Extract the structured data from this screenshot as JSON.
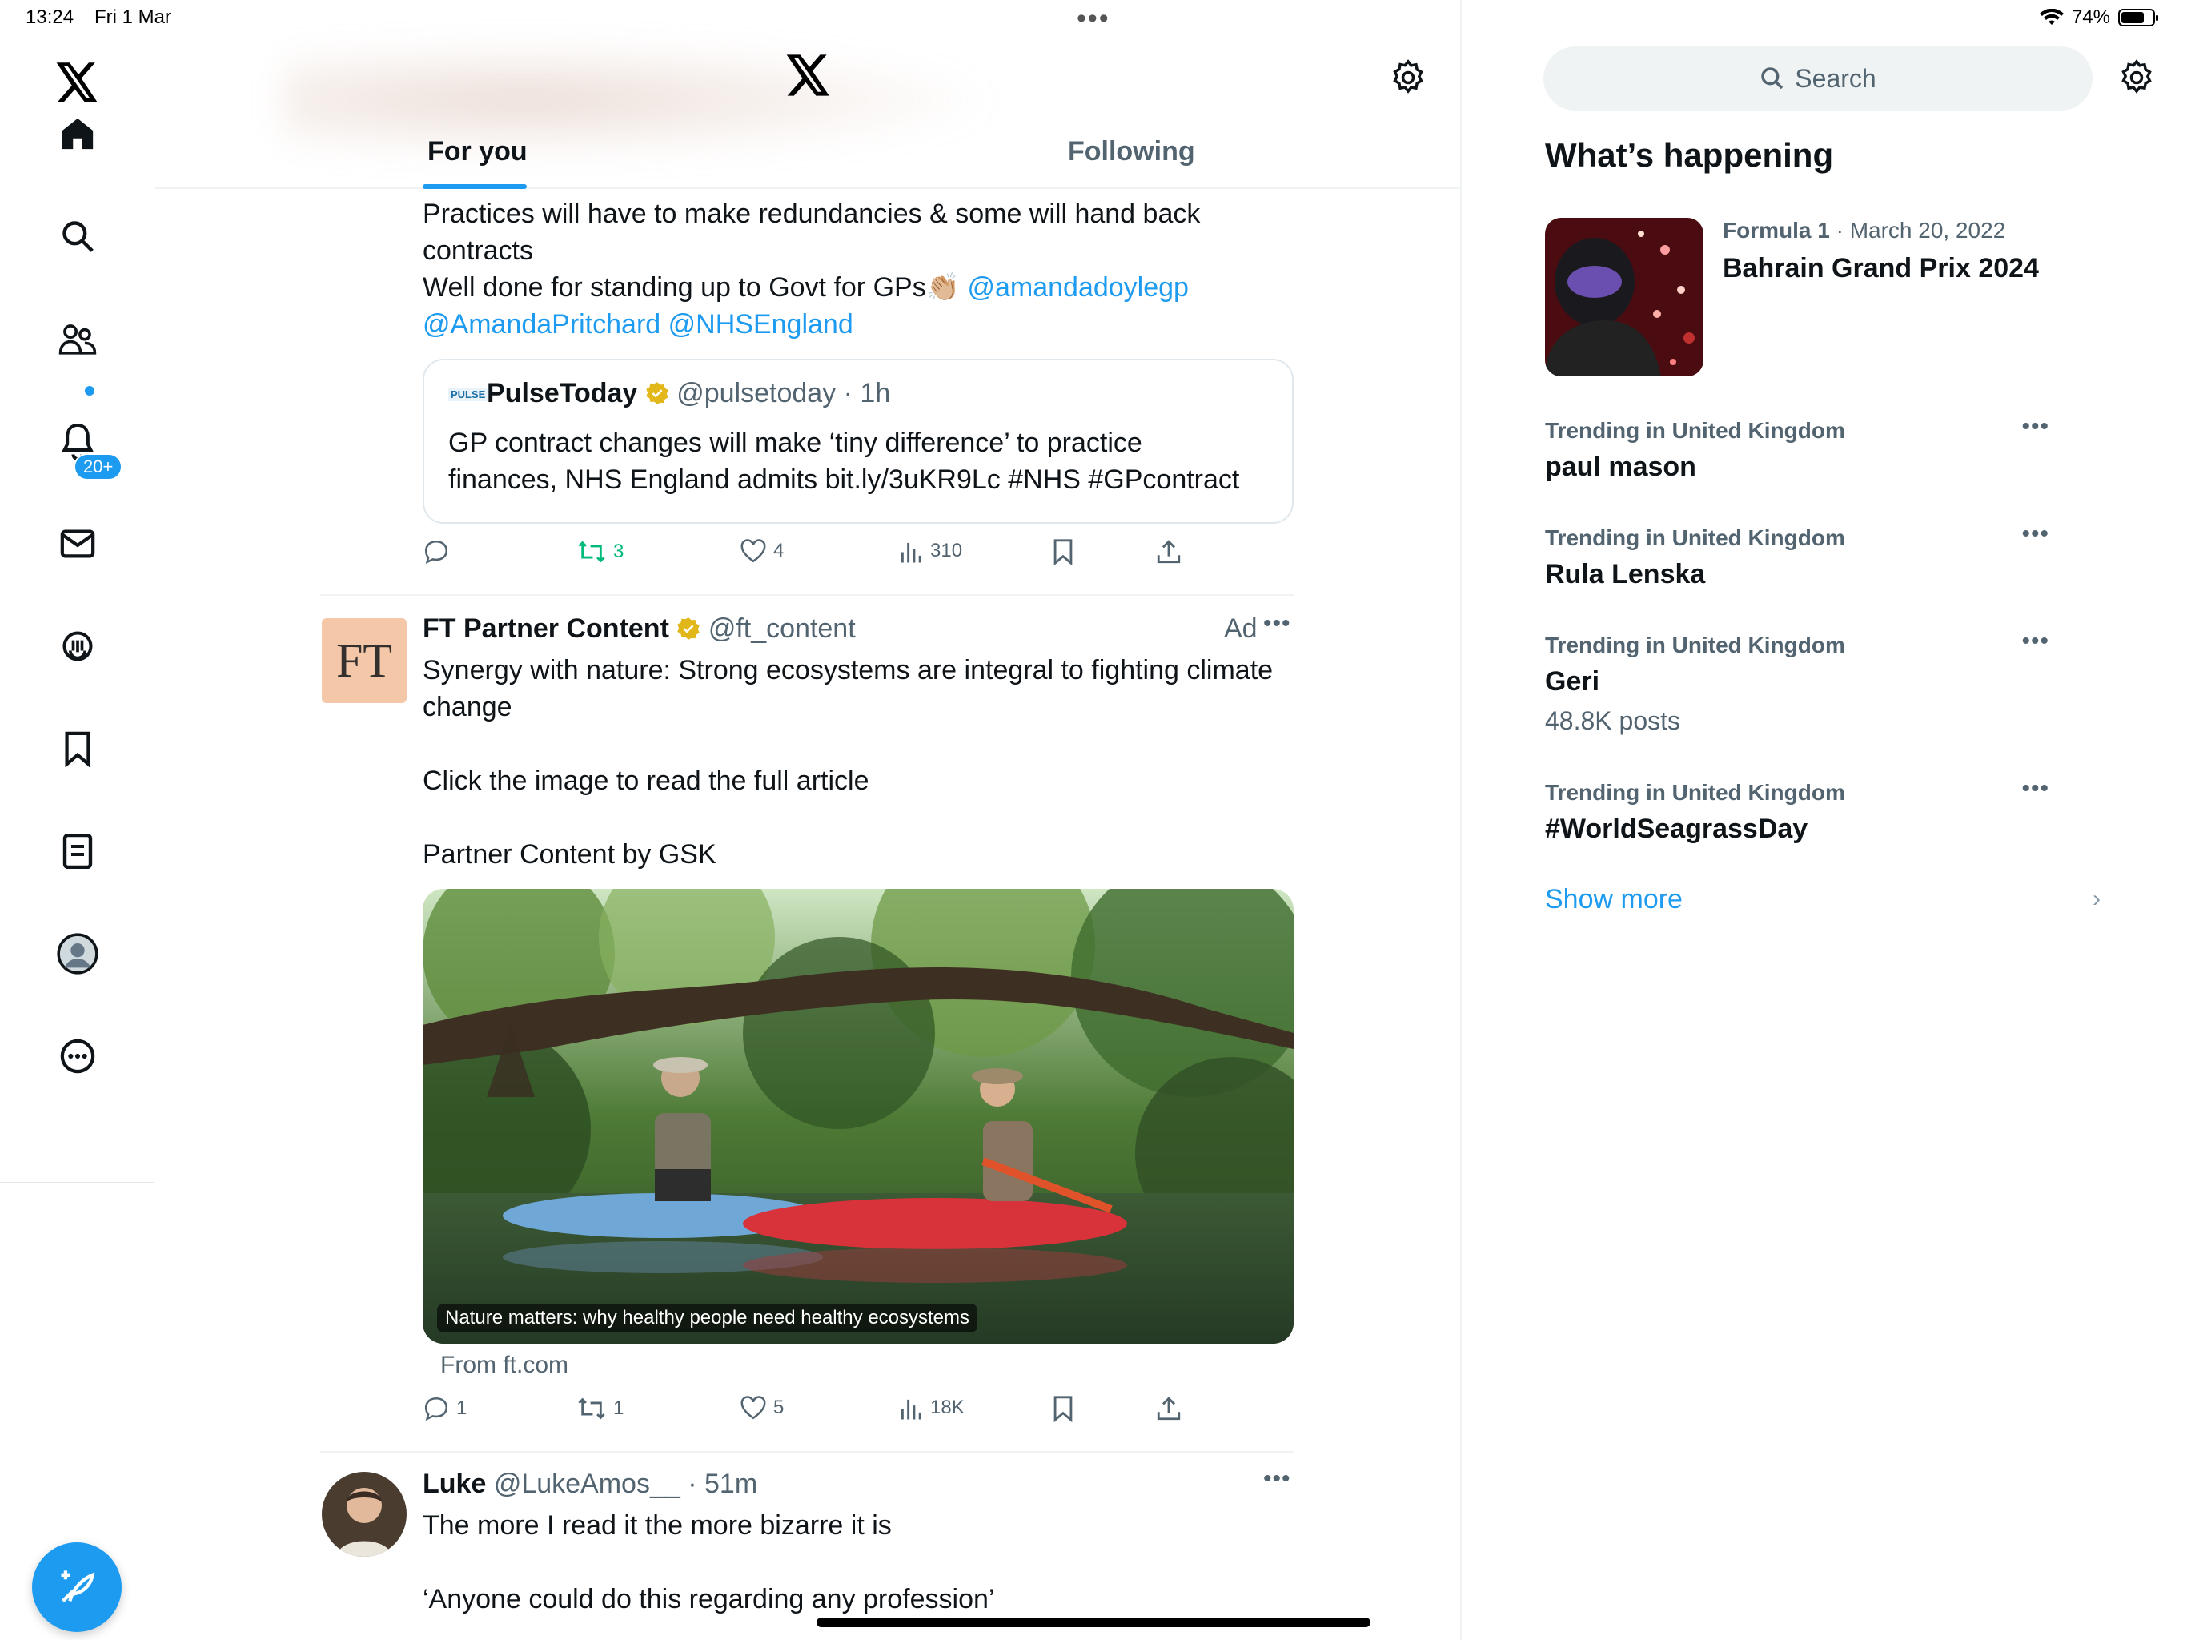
{
  "status_bar": {
    "time": "13:24",
    "date": "Fri 1 Mar",
    "battery": "74%"
  },
  "nav": {
    "notifications_badge": "20+",
    "items": [
      "home-icon",
      "search-icon",
      "communities-icon",
      "notifications-icon",
      "messages-icon",
      "grok-icon",
      "bookmarks-icon",
      "lists-icon",
      "profile-icon",
      "more-icon"
    ]
  },
  "header": {
    "tabs": [
      {
        "label": "For you",
        "active": true
      },
      {
        "label": "Following",
        "active": false
      }
    ]
  },
  "tweet1": {
    "line1": "Practices will have to make redundancies & some will hand back",
    "line2": "contracts",
    "line3a": "Well done for standing up to Govt for GPs👏🏼 ",
    "line3b": "@amandadoylegp",
    "line4a": "@AmandaPritchard",
    "line4b": "@NHSEngland",
    "quote": {
      "logo": "PULSE",
      "name": "PulseToday",
      "handle": "@pulsetoday",
      "time": "1h",
      "text1": "GP contract changes will make ‘tiny difference’ to practice",
      "text2": "finances, NHS England admits bit.ly/3uKR9Lc #NHS #GPcontract"
    },
    "stats": {
      "retweets": "3",
      "likes": "4",
      "views": "310"
    }
  },
  "tweet2": {
    "avatar": "FT",
    "name": "FT Partner Content",
    "handle": "@ft_content",
    "ad": "Ad",
    "text1": "Synergy with nature: Strong ecosystems are integral to fighting climate",
    "text2": "change",
    "text3": "Click the image to read the full article",
    "text4": "Partner Content by GSK",
    "image_caption": "Nature matters: why healthy people need healthy ecosystems",
    "source": "From ft.com",
    "stats": {
      "replies": "1",
      "retweets": "1",
      "likes": "5",
      "views": "18K"
    }
  },
  "tweet3": {
    "name": "Luke",
    "handle": "@LukeAmos__",
    "time": "51m",
    "text1": "The more I read it the more bizarre it is",
    "text2": "‘Anyone could do this regarding any profession’"
  },
  "sidebar": {
    "search_placeholder": "Search",
    "heading": "What’s happening",
    "event": {
      "category": "Formula 1",
      "date": "March 20, 2022",
      "title": "Bahrain Grand Prix 2024"
    },
    "trends": [
      {
        "context": "Trending in United Kingdom",
        "title": "paul mason",
        "posts": ""
      },
      {
        "context": "Trending in United Kingdom",
        "title": "Rula Lenska",
        "posts": ""
      },
      {
        "context": "Trending in United Kingdom",
        "title": "Geri",
        "posts": "48.8K posts"
      },
      {
        "context": "Trending in United Kingdom",
        "title": "#WorldSeagrassDay",
        "posts": ""
      }
    ],
    "show_more": "Show more"
  },
  "colors": {
    "accent": "#1d9bf0",
    "retweet_green": "#00ba7c",
    "text": "#0f1419",
    "muted": "#536471"
  }
}
